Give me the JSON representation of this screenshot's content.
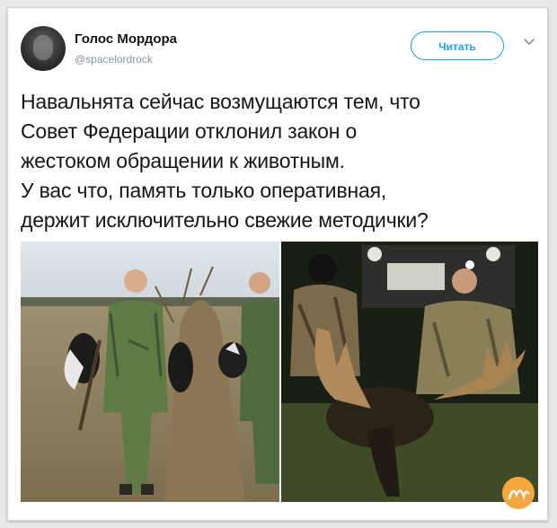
{
  "tweet": {
    "author": {
      "display_name": "Голос Мордора",
      "handle": "@spacelordrock"
    },
    "follow_label": "Читать",
    "text": "Навальнята сейчас возмущаются тем, что\nСовет Федерации отклонил закон о\nжестоком обращении к животным.\nУ вас что, память только оперативная,\nдержит исключительно свежие методички?"
  },
  "media": {
    "left_photo": "hunters-with-birds-photo",
    "right_photo": "hunters-with-moose-photo"
  },
  "icons": {
    "more": "chevron-down-icon",
    "watermark": "nyka-logo"
  },
  "colors": {
    "accent": "#1da1f2",
    "text": "#14171a",
    "muted": "#8a949c",
    "watermark": "#f4a640"
  }
}
